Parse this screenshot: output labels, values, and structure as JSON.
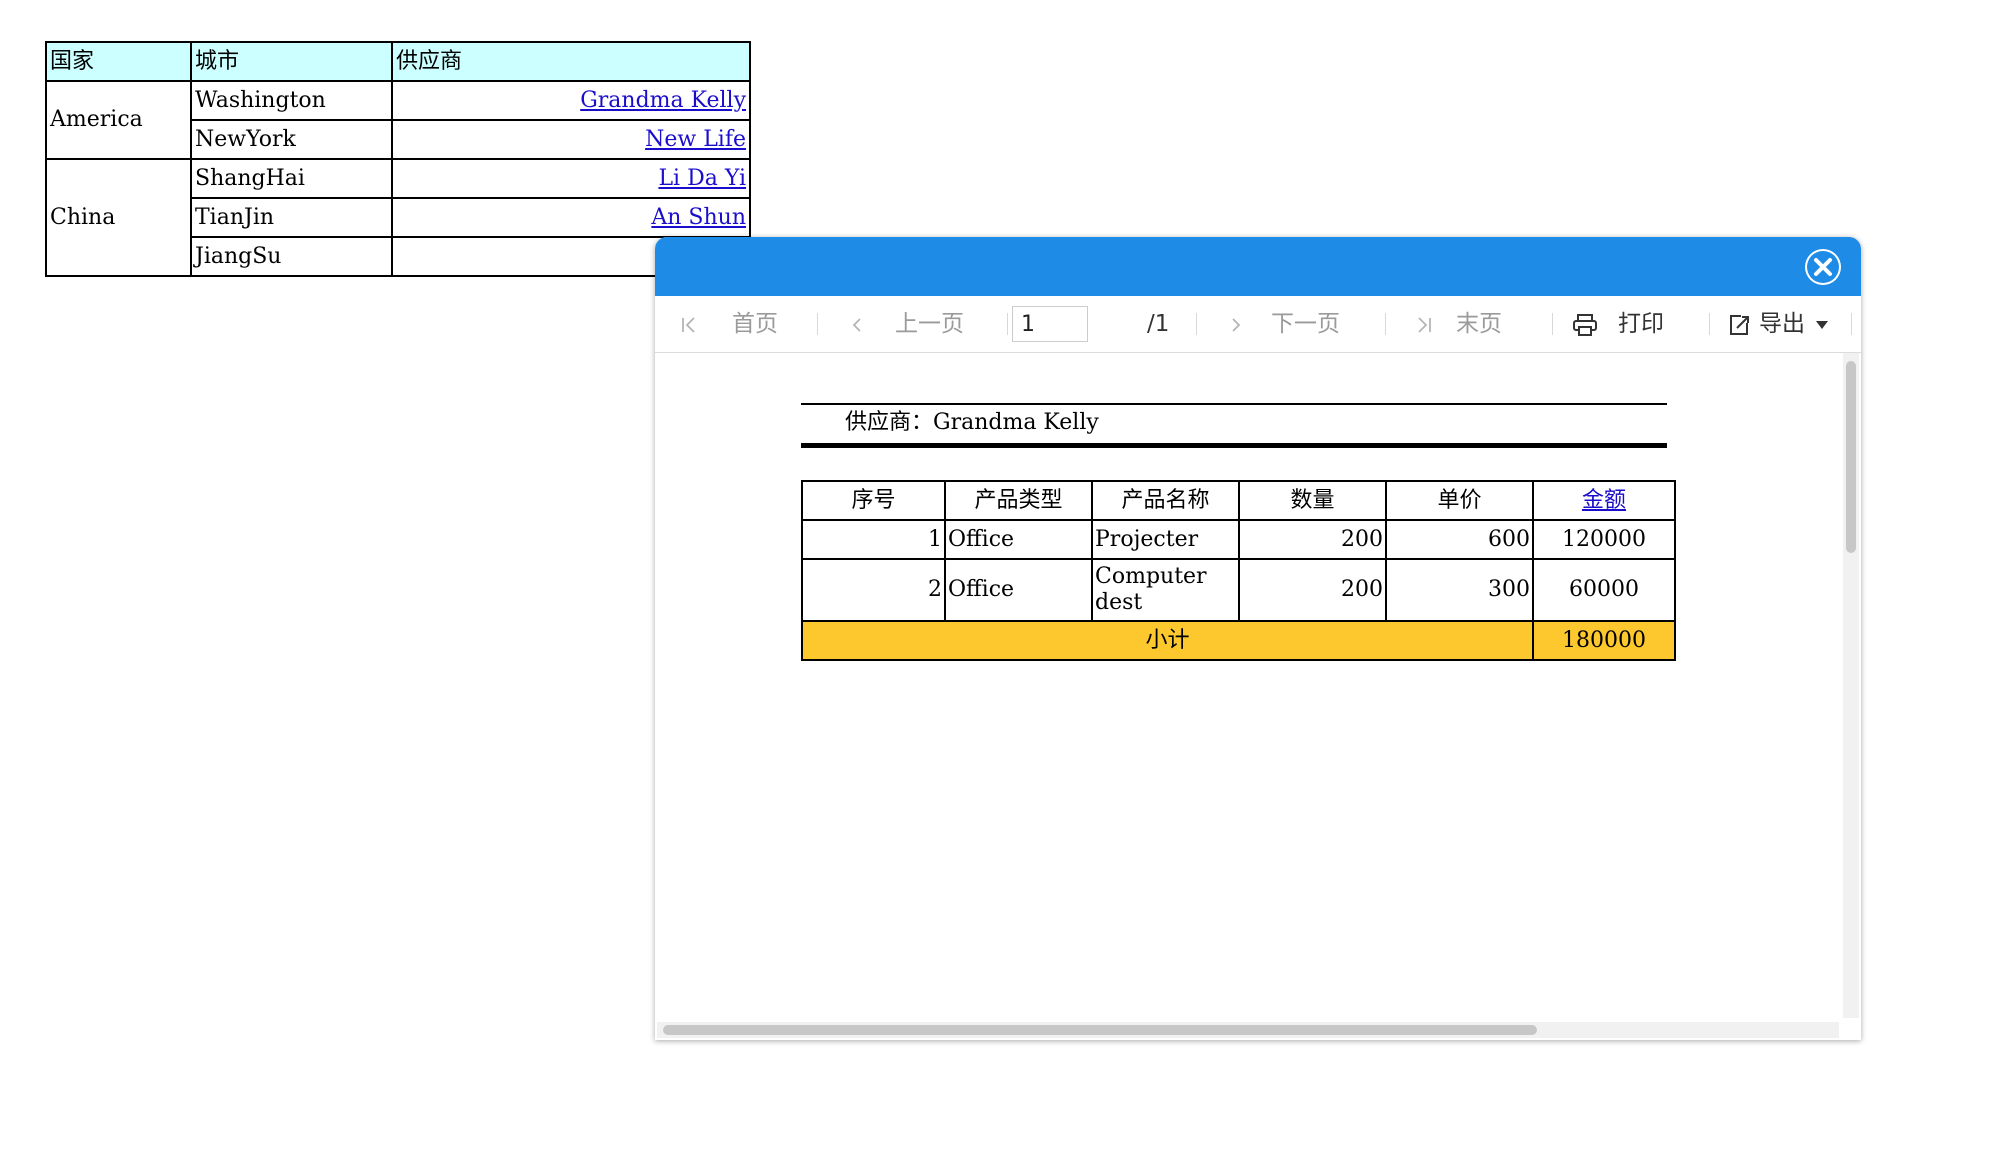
{
  "master": {
    "headers": [
      "国家",
      "城市",
      "供应商"
    ],
    "rows": [
      {
        "country": "America",
        "city": "Washington",
        "supplier": "Grandma Kelly"
      },
      {
        "city": "NewYork",
        "supplier": "New Life"
      },
      {
        "country": "China",
        "city": "ShangHai",
        "supplier": "Li Da Yi"
      },
      {
        "city": "TianJin",
        "supplier": "An Shun"
      },
      {
        "city": "JiangSu",
        "supplier": ""
      }
    ]
  },
  "toolbar": {
    "first": "首页",
    "prev": "上一页",
    "page_value": "1",
    "page_total": "/1",
    "next": "下一页",
    "last": "末页",
    "print": "打印",
    "export": "导出"
  },
  "report": {
    "supplier_line": "供应商：Grandma Kelly",
    "headers": [
      "序号",
      "产品类型",
      "产品名称",
      "数量",
      "单价",
      "金额"
    ],
    "rows": [
      {
        "no": "1",
        "type": "Office",
        "name": "Projecter",
        "qty": "200",
        "price": "600",
        "amount": "120000"
      },
      {
        "no": "2",
        "type": "Office",
        "name": "Computer dest",
        "qty": "200",
        "price": "300",
        "amount": "60000"
      }
    ],
    "subtotal_label": "小计",
    "subtotal_value": "180000"
  },
  "colors": {
    "header_blue": "#1e8ce6",
    "master_header_bg": "#ccffff",
    "subtotal_bg": "#fcc82e",
    "link": "#1a0dcc"
  }
}
